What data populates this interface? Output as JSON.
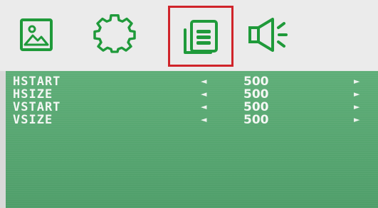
{
  "tabs": [
    {
      "icon": "picture-icon",
      "selected": false
    },
    {
      "icon": "gear-icon",
      "selected": false
    },
    {
      "icon": "display-settings-icon",
      "selected": true
    },
    {
      "icon": "speaker-icon",
      "selected": false
    }
  ],
  "colors": {
    "icon_green": "#1f9a3a",
    "selection_red": "#d0242a",
    "panel_green": "#58a872",
    "text": "#f4f7f4"
  },
  "menu": {
    "rows": [
      {
        "label": "HSTART",
        "decrement": "◄",
        "value": "500",
        "increment": "►"
      },
      {
        "label": "HSIZE",
        "decrement": "◄",
        "value": "500",
        "increment": "►"
      },
      {
        "label": "VSTART",
        "decrement": "◄",
        "value": "500",
        "increment": "►"
      },
      {
        "label": "VSIZE",
        "decrement": "◄",
        "value": "500",
        "increment": "►"
      }
    ]
  }
}
